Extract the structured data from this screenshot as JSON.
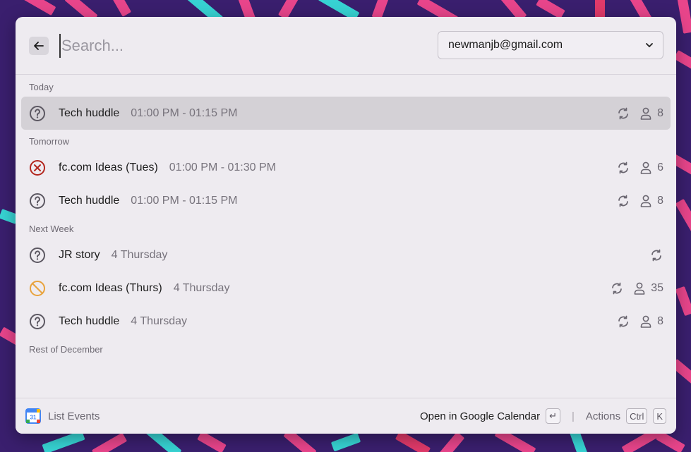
{
  "search": {
    "placeholder": "Search..."
  },
  "account": {
    "value": "newmanjb@gmail.com"
  },
  "sections": [
    {
      "title": "Today",
      "events": [
        {
          "status": "needs-action",
          "title": "Tech huddle",
          "time": "01:00 PM - 01:15 PM",
          "recurring": true,
          "attendees": "8",
          "selected": true
        }
      ]
    },
    {
      "title": "Tomorrow",
      "events": [
        {
          "status": "declined",
          "title": "fc.com Ideas (Tues)",
          "time": "01:00 PM - 01:30 PM",
          "recurring": true,
          "attendees": "6"
        },
        {
          "status": "needs-action",
          "title": "Tech huddle",
          "time": "01:00 PM - 01:15 PM",
          "recurring": true,
          "attendees": "8"
        }
      ]
    },
    {
      "title": "Next Week",
      "events": [
        {
          "status": "needs-action",
          "title": "JR story",
          "time": "4 Thursday",
          "recurring": true,
          "attendees": ""
        },
        {
          "status": "cancelled",
          "title": "fc.com Ideas (Thurs)",
          "time": "4 Thursday",
          "recurring": true,
          "attendees": "35"
        },
        {
          "status": "needs-action",
          "title": "Tech huddle",
          "time": "4 Thursday",
          "recurring": true,
          "attendees": "8"
        }
      ]
    },
    {
      "title": "Rest of December",
      "events": []
    }
  ],
  "footer": {
    "command_icon_text": "31",
    "command_title": "List Events",
    "primary_action": "Open in Google Calendar",
    "primary_key": "↵",
    "actions_label": "Actions",
    "actions_keys": [
      "Ctrl",
      "K"
    ]
  },
  "colors": {
    "declined": "#b3261e",
    "cancelled": "#e8a33d",
    "needs_action": "#5c5862"
  }
}
